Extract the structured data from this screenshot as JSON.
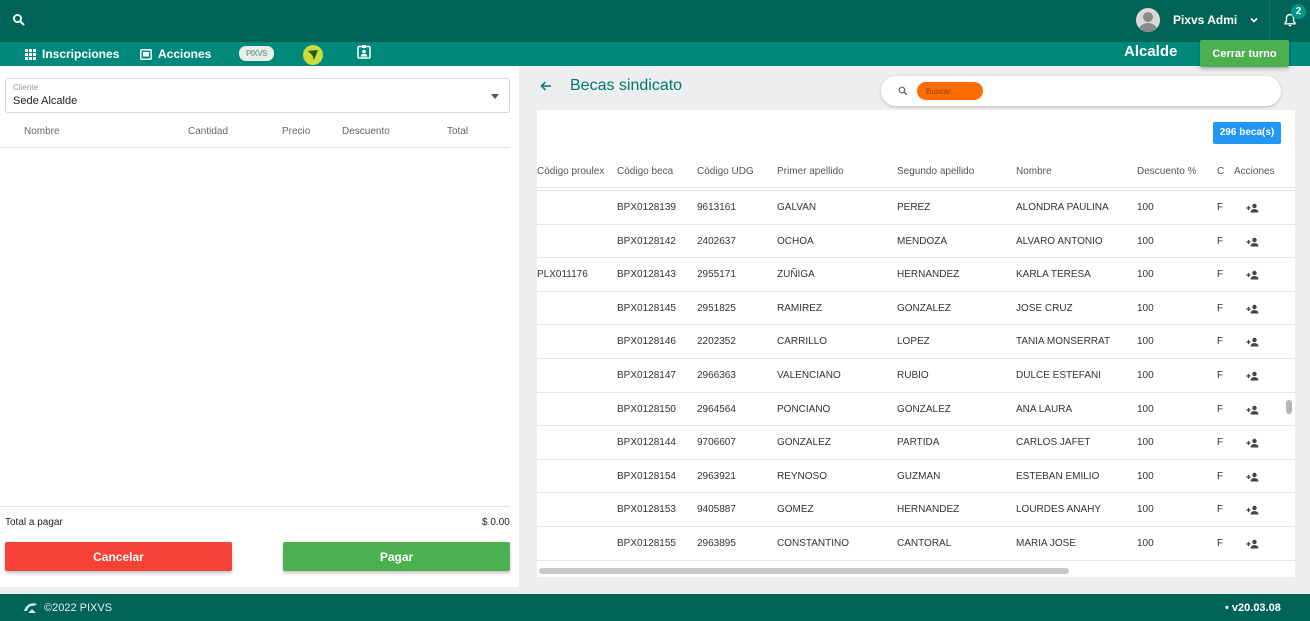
{
  "user": {
    "name": "Pixvs Admi",
    "notifications": "2"
  },
  "nav": {
    "items": [
      {
        "label": "Inscripciones",
        "icon": "grid-icon"
      },
      {
        "label": "Acciones",
        "icon": "card-icon"
      }
    ],
    "logo_text": "PIXVS",
    "branch": "Alcalde",
    "close_shift": "Cerrar turno"
  },
  "cart": {
    "client_label": "Cliente",
    "client_value": "Sede Alcalde",
    "columns": [
      "Nombre",
      "Cantidad",
      "Precio",
      "Descuento",
      "Total"
    ],
    "total_label": "Total a pagar",
    "total_value": "$ 0.00",
    "cancel": "Cancelar",
    "pay": "Pagar"
  },
  "panel": {
    "title": "Becas sindicato",
    "search_placeholder": "Buscar...",
    "count": "296 beca(s)"
  },
  "table": {
    "columns": [
      "Código proulex",
      "Código beca",
      "Código UDG",
      "Primer apellido",
      "Segundo apellido",
      "Nombre",
      "Descuento %",
      "C",
      "Acciones"
    ],
    "rows": [
      [
        "",
        "BPX0128139",
        "9613161",
        "GALVAN",
        "PEREZ",
        "ALONDRA PAULINA",
        "100",
        "F"
      ],
      [
        "",
        "BPX0128142",
        "2402637",
        "OCHOA",
        "MENDOZA",
        "ALVARO ANTONIO",
        "100",
        "F"
      ],
      [
        "PLX011176",
        "BPX0128143",
        "2955171",
        "ZUÑIGA",
        "HERNANDEZ",
        "KARLA TERESA",
        "100",
        "F"
      ],
      [
        "",
        "BPX0128145",
        "2951825",
        "RAMIREZ",
        "GONZALEZ",
        "JOSE CRUZ",
        "100",
        "F"
      ],
      [
        "",
        "BPX0128146",
        "2202352",
        "CARRILLO",
        "LOPEZ",
        "TANIA MONSERRAT",
        "100",
        "F"
      ],
      [
        "",
        "BPX0128147",
        "2966363",
        "VALENCIANO",
        "RUBIO",
        "DULCE ESTEFANI",
        "100",
        "F"
      ],
      [
        "",
        "BPX0128150",
        "2964564",
        "PONCIANO",
        "GONZALEZ",
        "ANA LAURA",
        "100",
        "F"
      ],
      [
        "",
        "BPX0128144",
        "9706607",
        "GONZALEZ",
        "PARTIDA",
        "CARLOS JAFET",
        "100",
        "F"
      ],
      [
        "",
        "BPX0128154",
        "2963921",
        "REYNOSO",
        "GUZMAN",
        "ESTEBAN EMILIO",
        "100",
        "F"
      ],
      [
        "",
        "BPX0128153",
        "9405887",
        "GOMEZ",
        "HERNANDEZ",
        "LOURDES ANAHY",
        "100",
        "F"
      ],
      [
        "",
        "BPX0128155",
        "2963895",
        "CONSTANTINO",
        "CANTORAL",
        "MARIA JOSE",
        "100",
        "F"
      ]
    ]
  },
  "footer": {
    "copyright": "©2022 PIXVS",
    "version": "• v20.03.08"
  }
}
